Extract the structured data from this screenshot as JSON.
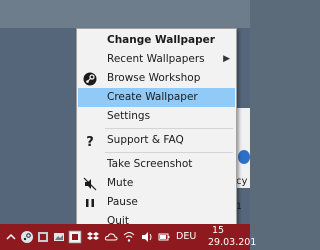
{
  "desktop": {
    "partial_text": "cy"
  },
  "menu": {
    "items": [
      {
        "label": "Change Wallpaper",
        "icon": "none"
      },
      {
        "label": "Recent Wallpapers",
        "icon": "none",
        "submenu": "▶"
      },
      {
        "label": "Browse Workshop",
        "icon": "steam-icon"
      },
      {
        "label": "Create Wallpaper",
        "icon": "none"
      },
      {
        "label": "Settings",
        "icon": "none"
      },
      {
        "label": "Support & FAQ",
        "icon": "question-icon"
      },
      {
        "label": "Take Screenshot",
        "icon": "none"
      },
      {
        "label": "Mute",
        "icon": "mute-icon"
      },
      {
        "label": "Pause",
        "icon": "pause-icon"
      },
      {
        "label": "Quit",
        "icon": "none"
      }
    ],
    "highlight_color": "#91c9f7"
  },
  "taskbar": {
    "color": "#8e1a20",
    "language": "DEU",
    "time_partial": "15",
    "date_partial": "29.03.201"
  }
}
